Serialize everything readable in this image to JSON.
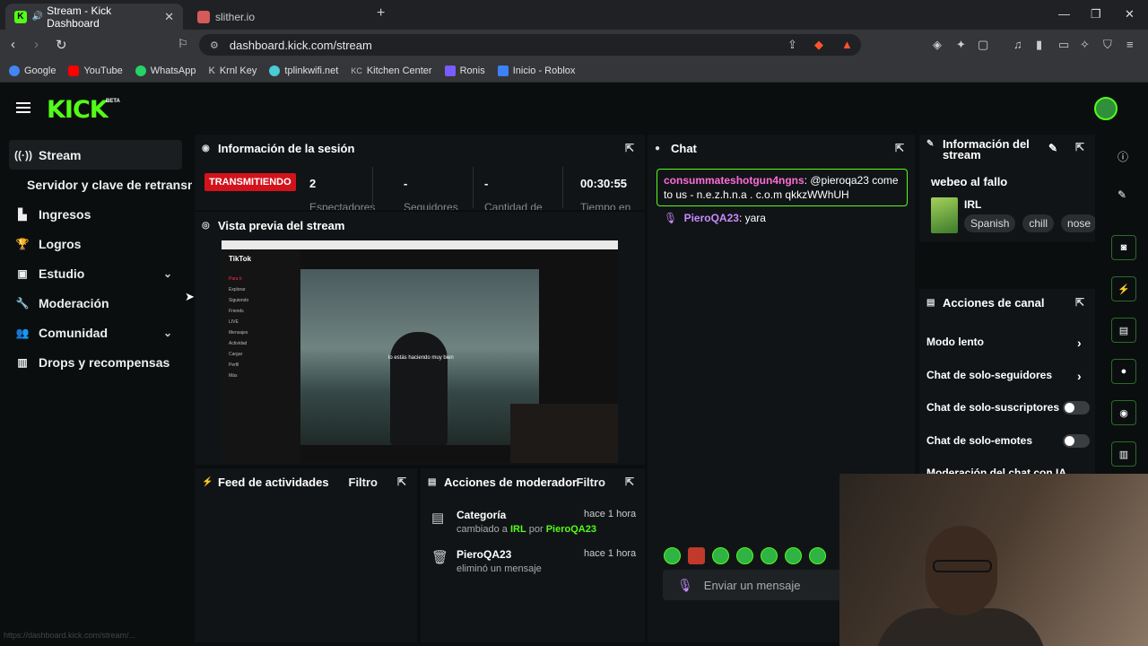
{
  "browser": {
    "tabs": [
      {
        "title": "Stream - Kick Dashboard",
        "favicon": "K",
        "color": "#53fc18",
        "active": true
      },
      {
        "title": "slither.io",
        "favicon": "",
        "color": "#d65a5a",
        "active": false
      }
    ],
    "address": "dashboard.kick.com/stream",
    "bookmarks": [
      {
        "label": "Google",
        "color": "#4285f4"
      },
      {
        "label": "YouTube",
        "color": "#ff0000"
      },
      {
        "label": "WhatsApp",
        "color": "#25d366"
      },
      {
        "label": "Krnl Key",
        "color": "#cccccc"
      },
      {
        "label": "tplinkwifi.net",
        "color": "#4acbd6"
      },
      {
        "label": "Kitchen Center",
        "color": "#888888"
      },
      {
        "label": "Ronis",
        "color": "#7b5cff"
      },
      {
        "label": "Inicio - Roblox",
        "color": "#3b82f6"
      }
    ],
    "status_url": "https://dashboard.kick.com/stream/..."
  },
  "brand": {
    "logo": "KICK",
    "beta": "BETA",
    "accent": "#53fc18"
  },
  "sidebar": {
    "items": [
      {
        "label": "Stream",
        "icon": "broadcast-icon",
        "glyph": "((·))",
        "active": true
      },
      {
        "label": "Servidor y clave de retransmisión",
        "sub": true
      },
      {
        "label": "Ingresos",
        "icon": "chart-icon",
        "glyph": "▙"
      },
      {
        "label": "Logros",
        "icon": "trophy-icon",
        "glyph": "🏆"
      },
      {
        "label": "Estudio",
        "icon": "studio-icon",
        "glyph": "▣",
        "expand": true
      },
      {
        "label": "Moderación",
        "icon": "wrench-icon",
        "glyph": "🔧"
      },
      {
        "label": "Comunidad",
        "icon": "users-icon",
        "glyph": "👥",
        "expand": true
      },
      {
        "label": "Drops y recompensas",
        "icon": "gift-icon",
        "glyph": "▥"
      }
    ]
  },
  "session": {
    "title": "Información de la sesión",
    "status": "TRANSMITIENDO",
    "stats": [
      {
        "value": "2",
        "label": "Espectadores"
      },
      {
        "value": "-",
        "label": "Seguidores"
      },
      {
        "value": "-",
        "label": "Cantidad de"
      },
      {
        "value": "00:30:55",
        "label": "Tiempo en"
      }
    ]
  },
  "preview": {
    "title": "Vista previa del stream",
    "app_name": "TikTok",
    "caption": "lo estás haciendo muy bien",
    "sidebar_items": [
      "Para ti",
      "Explorar",
      "Siguiendo",
      "Friends",
      "LIVE",
      "Mensajes",
      "Actividad",
      "Cargar",
      "Perfil",
      "Más"
    ]
  },
  "chat": {
    "title": "Chat",
    "messages": [
      {
        "user": "consummateshotgun4ngns",
        "text": "@pieroqa23 come to us - n.e.z.h.n.a . c.o.m qkkzWWhUH",
        "highlight": true
      },
      {
        "user": "PieroQA23",
        "text": "yara",
        "highlight": false
      }
    ],
    "input_placeholder": "Enviar un mensaje"
  },
  "stream_info": {
    "title": "Información del stream",
    "stream_title": "webeo al fallo",
    "category": "IRL",
    "tags": [
      "Spanish",
      "chill",
      "nose"
    ]
  },
  "channel_actions": {
    "title": "Acciones de canal",
    "items": [
      {
        "label": "Modo lento",
        "type": "arrow"
      },
      {
        "label": "Chat de solo-seguidores",
        "type": "arrow"
      },
      {
        "label": "Chat de solo-suscriptores",
        "type": "toggle"
      },
      {
        "label": "Chat de solo-emotes",
        "type": "toggle"
      },
      {
        "label": "Moderación del chat con IA",
        "type": "popout"
      }
    ]
  },
  "activity_feed": {
    "title": "Feed de actividades",
    "filter": "Filtro"
  },
  "mod_actions": {
    "title": "Acciones de moderador",
    "filter": "Filtro",
    "rows": [
      {
        "icon": "category-icon",
        "glyph": "▤",
        "title": "Categoría",
        "prefix": "cambiado a",
        "value": "IRL",
        "by": "por",
        "user": "PieroQA23",
        "time": "hace 1 hora"
      },
      {
        "icon": "trash-icon",
        "glyph": "🗑",
        "title": "PieroQA23",
        "sub": "eliminó un mensaje",
        "time": "hace 1 hora"
      }
    ]
  }
}
